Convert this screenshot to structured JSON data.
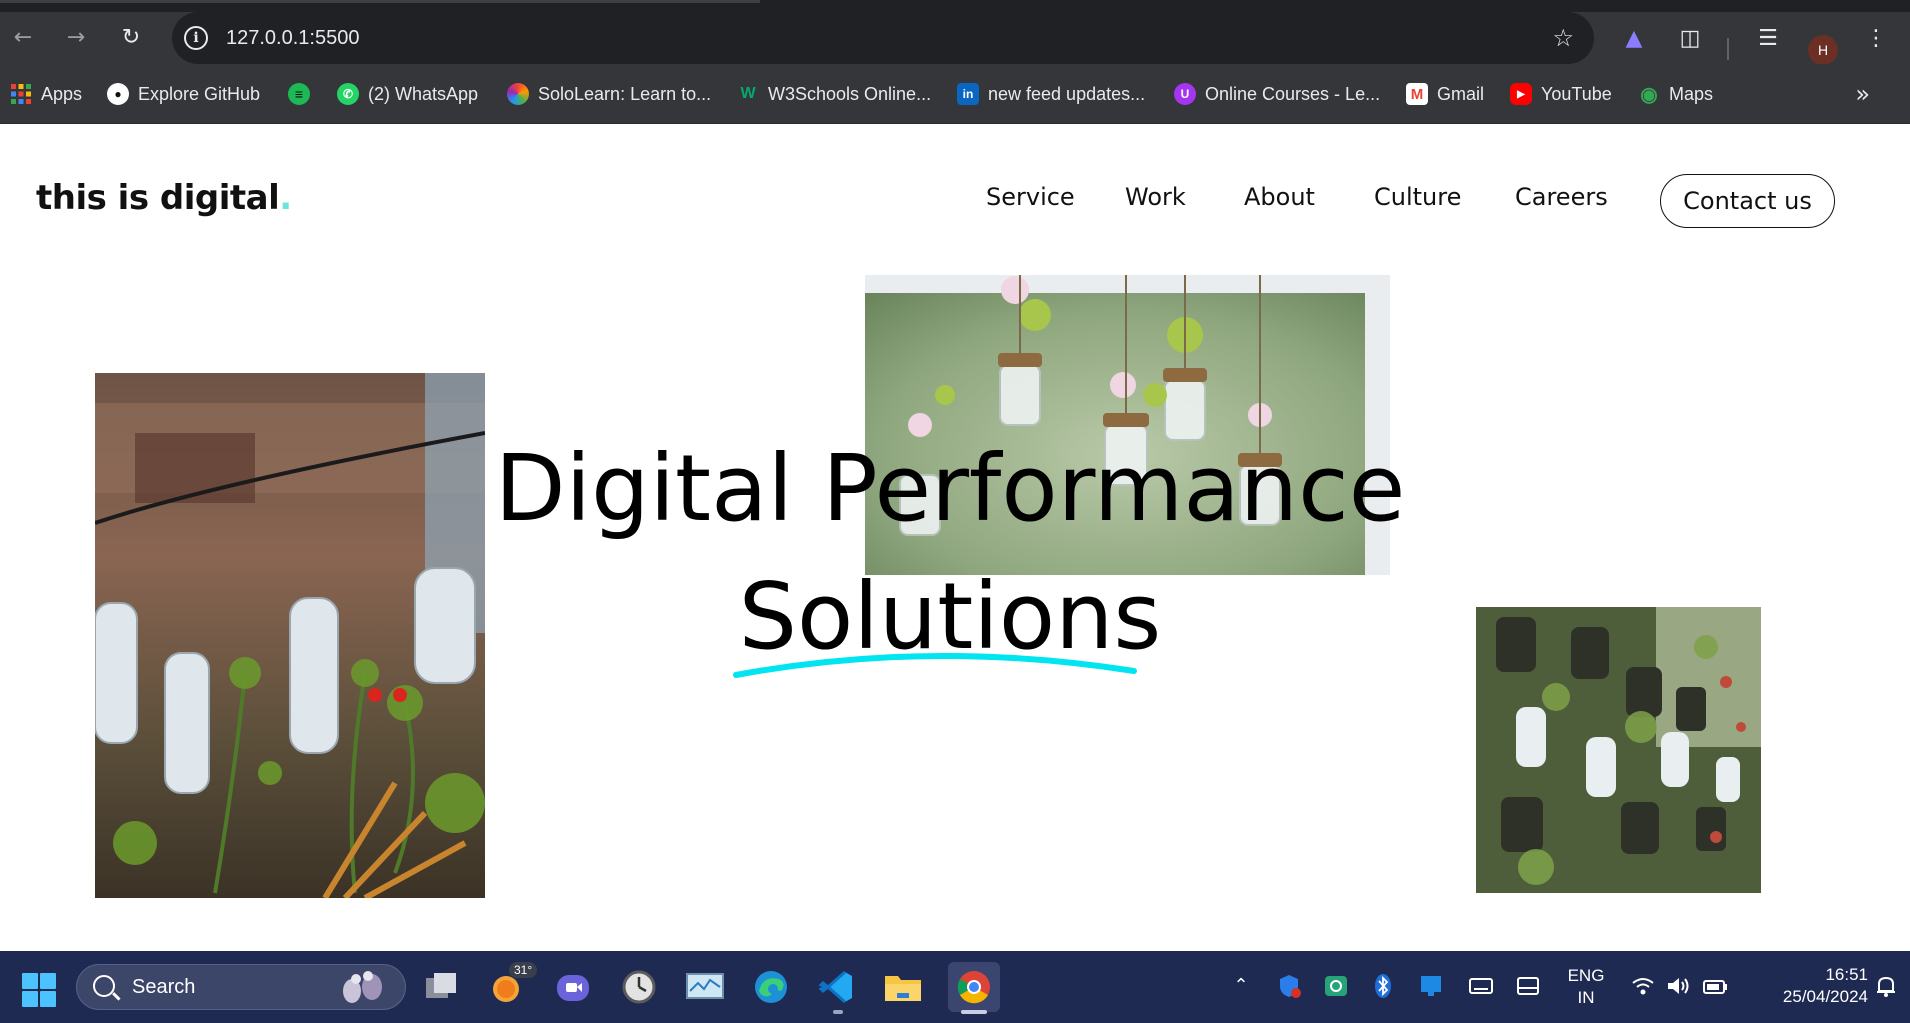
{
  "browser": {
    "url": "127.0.0.1:5500",
    "profile_initial": "H",
    "bookmarks": [
      {
        "label": "Apps",
        "icon": "apps-grid-icon"
      },
      {
        "label": "Explore GitHub",
        "icon": "github-icon"
      },
      {
        "label": "",
        "icon": "spotify-icon"
      },
      {
        "label": "(2) WhatsApp",
        "icon": "whatsapp-icon"
      },
      {
        "label": "SoloLearn: Learn to...",
        "icon": "sololearn-icon"
      },
      {
        "label": "W3Schools Online...",
        "icon": "w3schools-icon"
      },
      {
        "label": "new feed updates...",
        "icon": "linkedin-icon"
      },
      {
        "label": "Online Courses - Le...",
        "icon": "udemy-icon"
      },
      {
        "label": "Gmail",
        "icon": "gmail-icon"
      },
      {
        "label": "YouTube",
        "icon": "youtube-icon"
      },
      {
        "label": "Maps",
        "icon": "maps-icon"
      }
    ]
  },
  "site": {
    "logo_text": "this is digital",
    "logo_dot": ".",
    "nav": [
      "Service",
      "Work",
      "About",
      "Culture",
      "Careers"
    ],
    "contact_label": "Contact us",
    "hero_line1": "Digital Performance",
    "hero_line2": "Solutions",
    "accent_color": "#00e5f0"
  },
  "taskbar": {
    "search_label": "Search",
    "weather_badge": "31°",
    "lang_line1": "ENG",
    "lang_line2": "IN",
    "time": "16:51",
    "date": "25/04/2024"
  }
}
